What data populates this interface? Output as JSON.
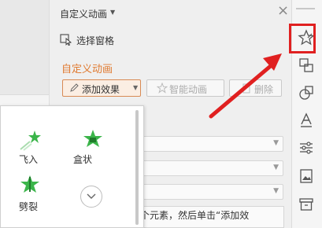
{
  "panel": {
    "title": "自定义动画",
    "select_pane_label": "选择窗格",
    "section_title": "自定义动画",
    "buttons": {
      "add_effect": "添加效果",
      "smart_animation": "智能动画",
      "delete": "删除"
    },
    "hint_text": "个元素，然后单击“添加效"
  },
  "popup": {
    "effects": [
      {
        "label": "飞入",
        "icon": "star-fly-in-icon"
      },
      {
        "label": "盒状",
        "icon": "star-box-icon"
      },
      {
        "label": "劈裂",
        "icon": "star-split-icon"
      }
    ],
    "more_icon": "chevron-down-icon"
  },
  "rightbar": {
    "icons": [
      "star-animation-icon",
      "swap-icon",
      "shapes-icon",
      "text-style-icon",
      "settings-sliders-icon",
      "image-icon",
      "archive-icon"
    ]
  },
  "colors": {
    "accent": "#e07a30",
    "highlight": "#e02020",
    "effect_green": "#3bb54a"
  }
}
